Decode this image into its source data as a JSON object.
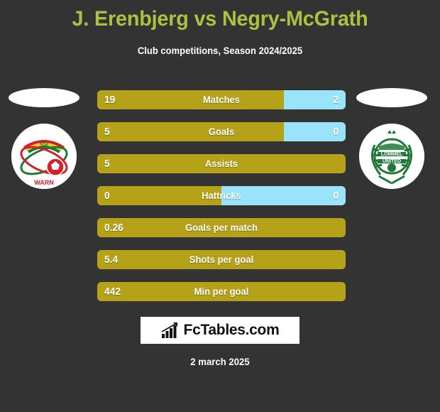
{
  "header": {
    "title": "J. Erenbjerg vs Negry-McGrath",
    "subtitle": "Club competitions, Season 2024/2025"
  },
  "colors": {
    "background": "#333333",
    "title": "#a9c23f",
    "bar_left": "#b5a219",
    "bar_right": "#99e4fb",
    "text": "#ffffff"
  },
  "teams": {
    "left": {
      "crest_name": "sv-warnemuende-crest",
      "crest_text": "SV"
    },
    "right": {
      "crest_name": "lommel-united-crest",
      "crest_text_1": "LOMMEL",
      "crest_text_2": "UNITED"
    }
  },
  "chart_data": {
    "type": "bar",
    "title": "J. Erenbjerg vs Negry-McGrath",
    "subtitle": "Club competitions, Season 2024/2025",
    "orientation": "horizontal-diverging",
    "categories": [
      "Matches",
      "Goals",
      "Assists",
      "Hattricks",
      "Goals per match",
      "Shots per goal",
      "Min per goal"
    ],
    "series": [
      {
        "name": "J. Erenbjerg",
        "values": [
          "19",
          "5",
          "5",
          "0",
          "0.26",
          "5.4",
          "442"
        ]
      },
      {
        "name": "Negry-McGrath",
        "values": [
          "2",
          "0",
          "",
          "0",
          "",
          "",
          ""
        ]
      }
    ],
    "left_fill_percent": [
      75,
      75,
      100,
      50,
      100,
      100,
      100
    ]
  },
  "rows": [
    {
      "label": "Matches",
      "left": "19",
      "right": "2",
      "left_pct": 75,
      "has_right": true
    },
    {
      "label": "Goals",
      "left": "5",
      "right": "0",
      "left_pct": 75,
      "has_right": true
    },
    {
      "label": "Assists",
      "left": "5",
      "right": "",
      "left_pct": 100,
      "has_right": false
    },
    {
      "label": "Hattricks",
      "left": "0",
      "right": "0",
      "left_pct": 50,
      "has_right": true
    },
    {
      "label": "Goals per match",
      "left": "0.26",
      "right": "",
      "left_pct": 100,
      "has_right": false
    },
    {
      "label": "Shots per goal",
      "left": "5.4",
      "right": "",
      "left_pct": 100,
      "has_right": false
    },
    {
      "label": "Min per goal",
      "left": "442",
      "right": "",
      "left_pct": 100,
      "has_right": false
    }
  ],
  "footer": {
    "logo_text": "FcTables.com",
    "date": "2 march 2025"
  }
}
